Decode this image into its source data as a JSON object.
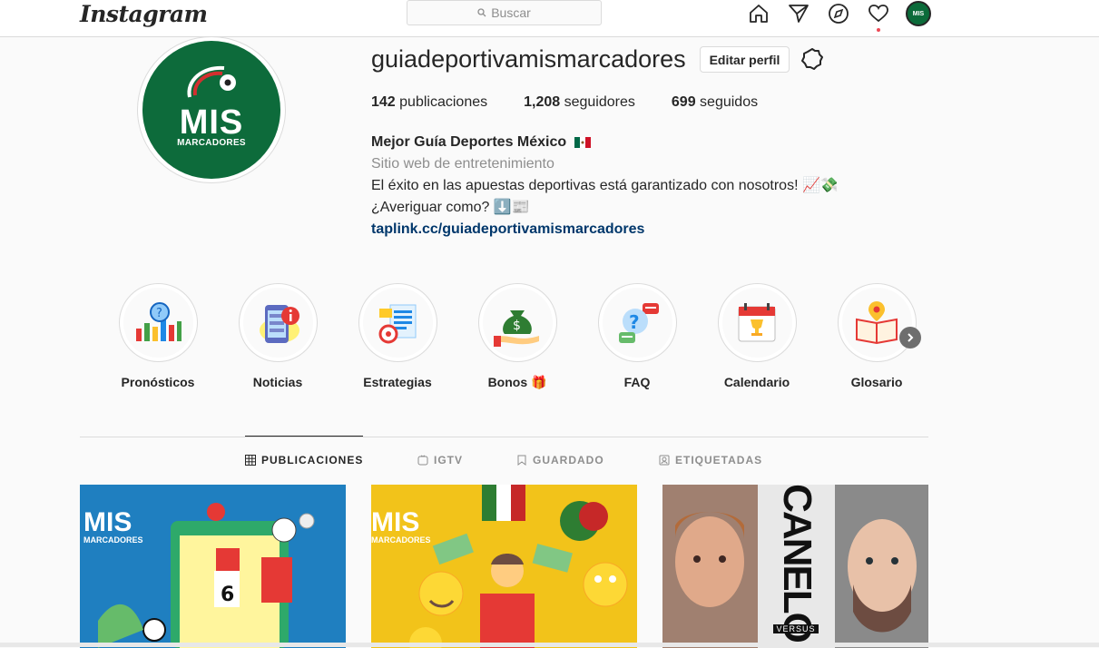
{
  "nav": {
    "logo": "Instagram",
    "search_placeholder": "Buscar"
  },
  "profile": {
    "username": "guiadeportivamismarcadores",
    "edit_button": "Editar perfil",
    "avatar_text_main": "MIS",
    "avatar_text_sub": "MARCADORES",
    "stats": [
      {
        "value": "142",
        "label": "publicaciones"
      },
      {
        "value": "1,208",
        "label": "seguidores"
      },
      {
        "value": "699",
        "label": "seguidos"
      }
    ],
    "bio": {
      "name": "Mejor Guía Deportes México",
      "category": "Sitio web de entretenimiento",
      "line1": "El éxito en las apuestas deportivas está garantizado con nosotros! 📈💸",
      "line2": "¿Averiguar como? ⬇️📰",
      "link": "taplink.cc/guiadeportivamismarcadores"
    }
  },
  "highlights": [
    {
      "label": "Pronósticos",
      "icon": "chart-icon"
    },
    {
      "label": "Noticias",
      "icon": "news-phone-icon"
    },
    {
      "label": "Estrategias",
      "icon": "strategy-icon"
    },
    {
      "label": "Bonos 🎁",
      "icon": "money-bag-icon"
    },
    {
      "label": "FAQ",
      "icon": "question-chat-icon"
    },
    {
      "label": "Calendario",
      "icon": "calendar-icon"
    },
    {
      "label": "Glosario",
      "icon": "book-icon"
    }
  ],
  "tabs": [
    {
      "label": "PUBLICACIONES",
      "active": true
    },
    {
      "label": "IGTV",
      "active": false
    },
    {
      "label": "GUARDADO",
      "active": false
    },
    {
      "label": "ETIQUETADAS",
      "active": false
    }
  ],
  "posts": [
    {
      "overlay_main": "MIS",
      "overlay_sub": "MARCADORES"
    },
    {
      "overlay_main": "MIS",
      "overlay_sub": "MARCADORES"
    },
    {
      "overlay_main": "CANELO",
      "overlay_sub": "VERSUS"
    }
  ],
  "colors": {
    "brand_green": "#0d6b3b",
    "link": "#00376b",
    "notification": "#ed4956"
  }
}
